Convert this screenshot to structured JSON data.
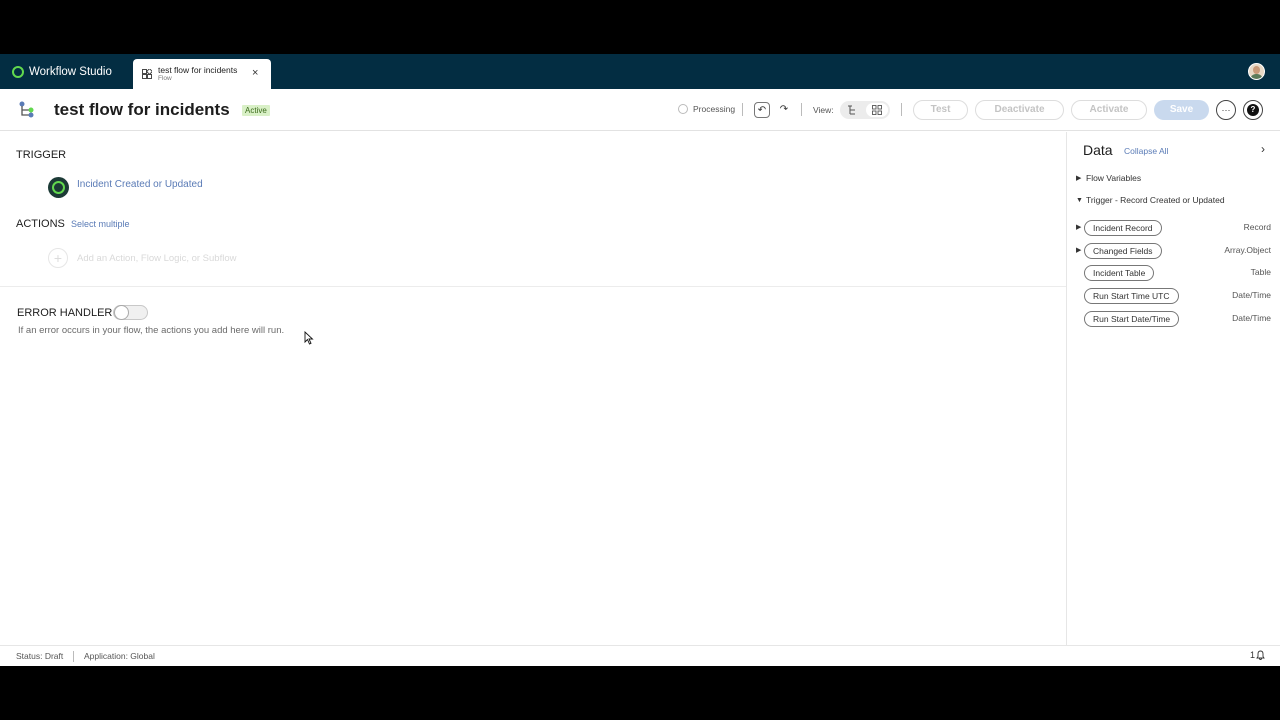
{
  "appbar": {
    "brand": "Workflow Studio",
    "tab": {
      "title": "test flow for incidents",
      "subtitle": "Flow",
      "close": "×"
    }
  },
  "header": {
    "title": "test flow for incidents",
    "status_badge": "Active",
    "processing": "Processing",
    "undo": "↶",
    "redo": "↷",
    "view_label": "View:",
    "buttons": {
      "test": "Test",
      "deactivate": "Deactivate",
      "activate": "Activate",
      "save": "Save",
      "more": "···",
      "help": "?"
    }
  },
  "canvas": {
    "trigger_label": "TRIGGER",
    "trigger_name": "Incident Created or Updated",
    "actions_label": "ACTIONS",
    "select_multiple": "Select multiple",
    "add_plus": "+",
    "add_hint": "Add an Action, Flow Logic, or Subflow",
    "error_handler_label": "ERROR HANDLER",
    "error_handler_enabled": false,
    "error_handler_desc": "If an error occurs in your flow, the actions you add here will run."
  },
  "data_panel": {
    "title": "Data",
    "collapse_all": "Collapse All",
    "chevron": "›",
    "tree": [
      {
        "label": "Flow Variables",
        "expanded": false
      },
      {
        "label": "Trigger - Record Created or Updated",
        "expanded": true
      }
    ],
    "pills": [
      {
        "label": "Incident Record",
        "type": "Record",
        "has_caret": true
      },
      {
        "label": "Changed Fields",
        "type": "Array.Object",
        "has_caret": true
      },
      {
        "label": "Incident Table",
        "type": "Table",
        "has_caret": false
      },
      {
        "label": "Run Start Time UTC",
        "type": "Date/Time",
        "has_caret": false
      },
      {
        "label": "Run Start Date/Time",
        "type": "Date/Time",
        "has_caret": false
      }
    ]
  },
  "statusbar": {
    "status": "Status: Draft",
    "application": "Application: Global",
    "notifications": "1"
  },
  "colors": {
    "appbar_bg": "#032d42",
    "brand_green": "#62d84e",
    "link_blue": "#5a7bb6",
    "active_badge_bg": "#d9f0c7"
  },
  "icons": [
    "workflow-logo-icon",
    "flow-tab-icon",
    "close-icon",
    "flow-diagram-icon",
    "undo-icon",
    "redo-icon",
    "list-view-icon",
    "diagram-view-icon",
    "more-icon",
    "help-icon",
    "trigger-record-icon",
    "plus-icon",
    "chevron-right-icon",
    "caret-right-icon",
    "caret-down-icon",
    "bell-icon",
    "cursor-icon"
  ]
}
